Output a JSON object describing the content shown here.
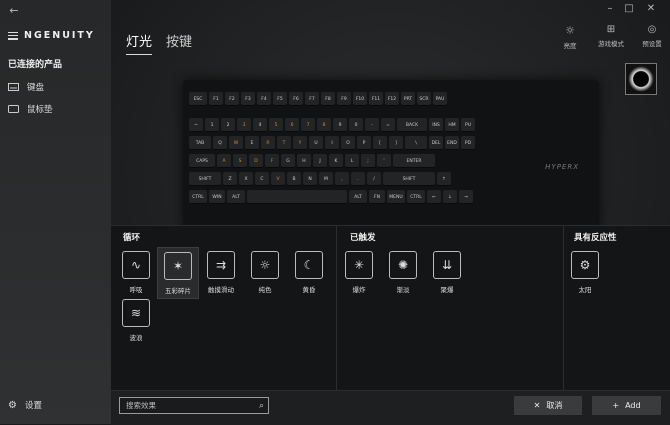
{
  "app": {
    "brand": "NGENUITY"
  },
  "sidebar": {
    "section_title": "已连接的产品",
    "items": [
      {
        "label": "键盘",
        "icon": "keyboard-icon"
      },
      {
        "label": "鼠标垫",
        "icon": "mousepad-icon"
      }
    ],
    "settings_label": "设置"
  },
  "tabs": [
    {
      "label": "灯光",
      "active": true
    },
    {
      "label": "按键",
      "active": false
    }
  ],
  "toolbar": {
    "brightness": "亮度",
    "game_mode": "游戏模式",
    "preset": "预设置"
  },
  "keyboard": {
    "row0": [
      "ESC",
      "F1",
      "F2",
      "F3",
      "F4",
      "F5",
      "F6",
      "F7",
      "F8",
      "F9",
      "F10",
      "F11",
      "F12",
      "PRT",
      "SCR",
      "PAU"
    ],
    "row1": [
      "~",
      "1",
      "2",
      "3",
      "4",
      "5",
      "6",
      "7",
      "8",
      "9",
      "0",
      "-",
      "=",
      "BACK",
      "INS",
      "HM",
      "PU"
    ],
    "row2": [
      "TAB",
      "Q",
      "W",
      "E",
      "R",
      "T",
      "Y",
      "U",
      "I",
      "O",
      "P",
      "[",
      "]",
      "\\",
      "DEL",
      "END",
      "PD"
    ],
    "row3": [
      "CAPS",
      "A",
      "S",
      "D",
      "F",
      "G",
      "H",
      "J",
      "K",
      "L",
      ";",
      "'",
      "ENTER"
    ],
    "row4": [
      "SHIFT",
      "Z",
      "X",
      "C",
      "V",
      "B",
      "N",
      "M",
      ",",
      ".",
      "/",
      "SHIFT",
      "↑"
    ],
    "row5": [
      "CTRL",
      "WIN",
      "ALT",
      "",
      "ALT",
      "FN",
      "MENU",
      "CTRL",
      "←",
      "↓",
      "→"
    ],
    "logo": "HYPERX"
  },
  "effects": {
    "loop": {
      "title": "循环",
      "items": [
        {
          "label": "呼吸",
          "icon": "wave-sine-icon",
          "glyph": "∿"
        },
        {
          "label": "五彩碎片",
          "icon": "confetti-icon",
          "glyph": "✶",
          "selected": true
        },
        {
          "label": "触摸滑动",
          "icon": "swipe-icon",
          "glyph": "⇉"
        },
        {
          "label": "纯色",
          "icon": "sun-solid-icon",
          "glyph": "☼"
        },
        {
          "label": "黄昏",
          "icon": "moon-icon",
          "glyph": "☾"
        },
        {
          "label": "波浪",
          "icon": "wave-icon",
          "glyph": "≋"
        }
      ]
    },
    "triggered": {
      "title": "已触发",
      "items": [
        {
          "label": "爆炸",
          "icon": "explosion-icon",
          "glyph": "✳"
        },
        {
          "label": "渐淡",
          "icon": "fade-icon",
          "glyph": "✺"
        },
        {
          "label": "聚爆",
          "icon": "implode-icon",
          "glyph": "⇊"
        }
      ]
    },
    "reactive": {
      "title": "具有反应性",
      "items": [
        {
          "label": "太阳",
          "icon": "sun-gear-icon",
          "glyph": "⚙"
        }
      ]
    }
  },
  "bottom": {
    "search_placeholder": "搜索效果",
    "cancel_label": "取消",
    "add_label": "Add"
  },
  "colors": {
    "accent_orange": "#d38a2f",
    "panel_bg": "#141516"
  }
}
